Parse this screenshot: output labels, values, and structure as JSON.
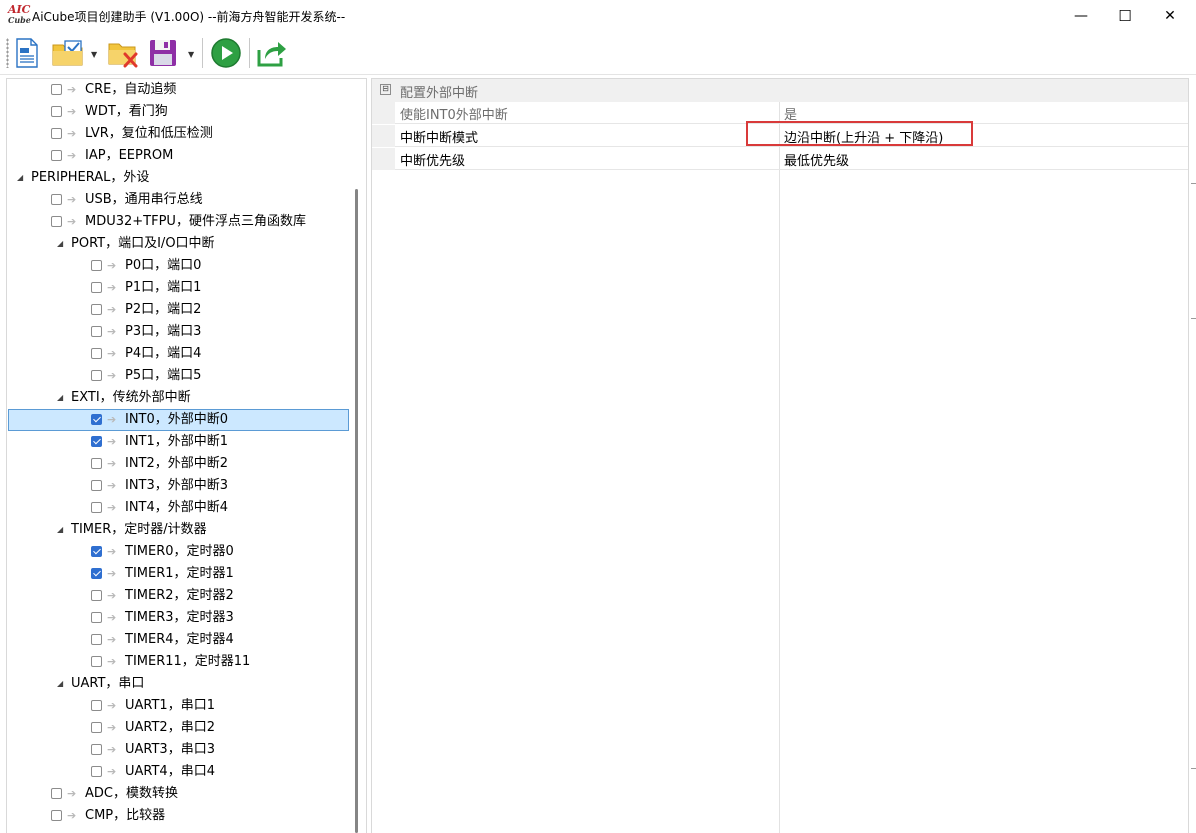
{
  "window": {
    "title": "AiCube项目创建助手 (V1.00O) --前海方舟智能开发系统--",
    "logo_top": "AIC",
    "logo_bottom": "Cube",
    "minimize": "—",
    "maximize": "☐",
    "close": "✕"
  },
  "toolbar": {
    "buttons": [
      "new-document-icon",
      "open-folder-check-icon",
      "delete-folder-icon",
      "save-floppy-icon",
      "run-play-icon",
      "export-share-icon"
    ],
    "accent_green": "#2ea043"
  },
  "tree": {
    "items": [
      {
        "label": "CRE，自动追频",
        "checked": false
      },
      {
        "label": "WDT，看门狗",
        "checked": false
      },
      {
        "label": "LVR，复位和低压检测",
        "checked": false
      },
      {
        "label": "IAP，EEPROM",
        "checked": false
      },
      {
        "label": "PERIPHERAL，外设",
        "group": true
      },
      {
        "label": "USB，通用串行总线",
        "checked": false
      },
      {
        "label": "MDU32+TFPU，硬件浮点三角函数库",
        "checked": false
      },
      {
        "label": "PORT，端口及I/O口中断",
        "group": true
      },
      {
        "label": "P0口，端口0",
        "checked": false
      },
      {
        "label": "P1口，端口1",
        "checked": false
      },
      {
        "label": "P2口，端口2",
        "checked": false
      },
      {
        "label": "P3口，端口3",
        "checked": false
      },
      {
        "label": "P4口，端口4",
        "checked": false
      },
      {
        "label": "P5口，端口5",
        "checked": false
      },
      {
        "label": "EXTI，传统外部中断",
        "group": true
      },
      {
        "label": "INT0，外部中断0",
        "checked": true,
        "selected": true
      },
      {
        "label": "INT1，外部中断1",
        "checked": true
      },
      {
        "label": "INT2，外部中断2",
        "checked": false
      },
      {
        "label": "INT3，外部中断3",
        "checked": false
      },
      {
        "label": "INT4，外部中断4",
        "checked": false
      },
      {
        "label": "TIMER，定时器/计数器",
        "group": true
      },
      {
        "label": "TIMER0，定时器0",
        "checked": true
      },
      {
        "label": "TIMER1，定时器1",
        "checked": true
      },
      {
        "label": "TIMER2，定时器2",
        "checked": false
      },
      {
        "label": "TIMER3，定时器3",
        "checked": false
      },
      {
        "label": "TIMER4，定时器4",
        "checked": false
      },
      {
        "label": "TIMER11，定时器11",
        "checked": false
      },
      {
        "label": "UART，串口",
        "group": true
      },
      {
        "label": "UART1，串口1",
        "checked": false
      },
      {
        "label": "UART2，串口2",
        "checked": false
      },
      {
        "label": "UART3，串口3",
        "checked": false
      },
      {
        "label": "UART4，串口4",
        "checked": false
      },
      {
        "label": "ADC，模数转换",
        "checked": false
      },
      {
        "label": "CMP，比较器",
        "checked": false
      }
    ]
  },
  "properties": {
    "category": "配置外部中断",
    "collapse_symbol": "⊟",
    "rows": [
      {
        "name": "使能INT0外部中断",
        "value": "是",
        "dim": true
      },
      {
        "name": "中断中断模式",
        "value": "边沿中断(上升沿 + 下降沿)",
        "highlight": true
      },
      {
        "name": "中断优先级",
        "value": "最低优先级"
      }
    ],
    "highlight_color": "#d93a3a"
  }
}
